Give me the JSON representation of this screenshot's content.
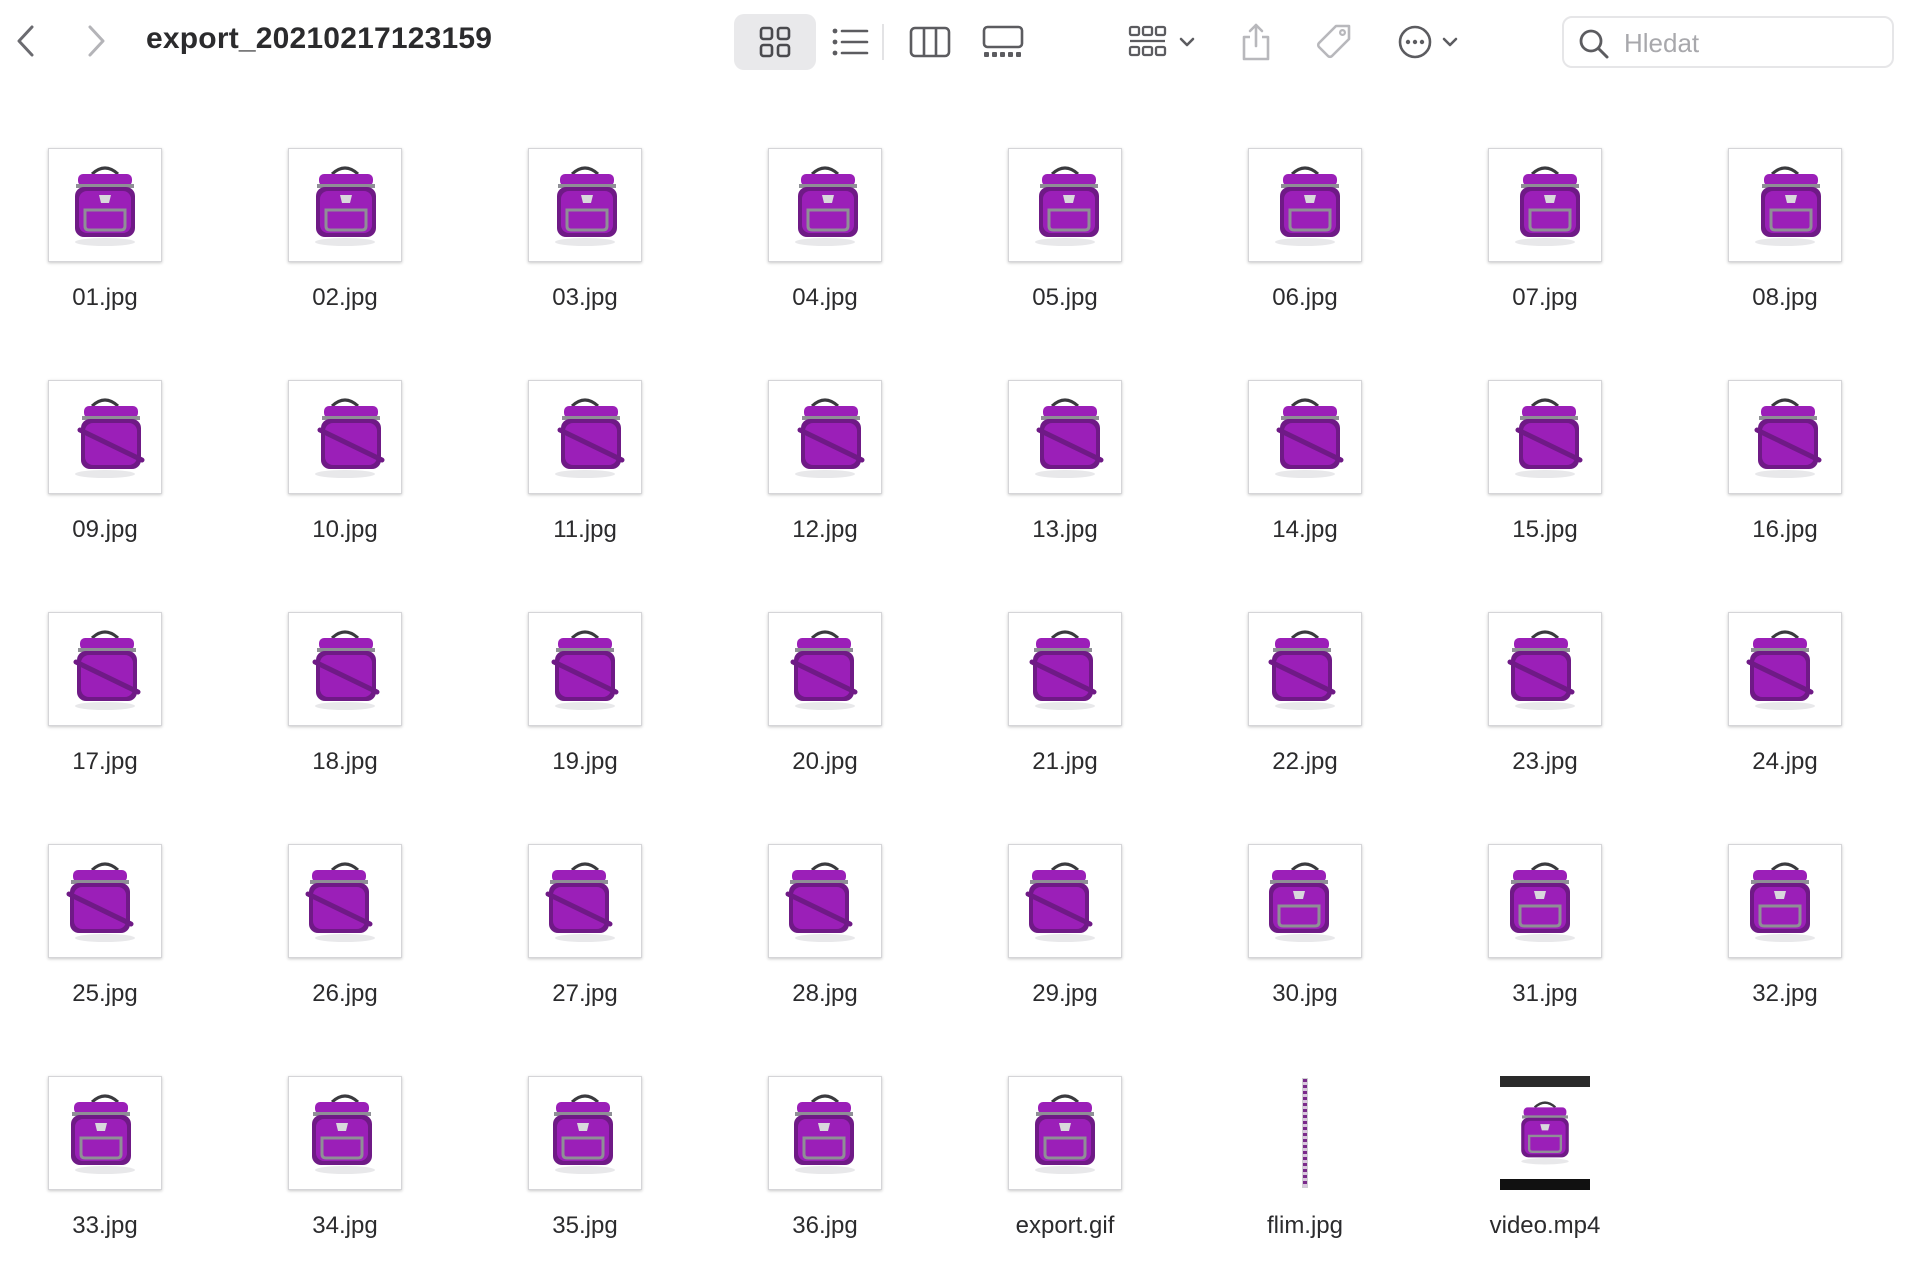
{
  "window": {
    "title": "export_20210217123159"
  },
  "toolbar": {
    "back_icon": "chevron-left-icon",
    "forward_icon": "chevron-right-icon",
    "view_modes": [
      "icons",
      "list",
      "columns",
      "gallery"
    ],
    "active_view": "icons",
    "group_icon": "group-grid-icon",
    "share_icon": "share-icon",
    "tags_icon": "tag-icon",
    "action_icon": "ellipsis-circle-icon"
  },
  "search": {
    "placeholder": "Hledat",
    "value": ""
  },
  "colors": {
    "accent_purple": "#9b1fb8",
    "bag_dark": "#6f1a86",
    "bag_gray": "#8f8f96",
    "toolbar_icon": "#5c5c60",
    "active_view_bg": "#e9e9eb"
  },
  "files": [
    {
      "name": "01.jpg",
      "kind": "image"
    },
    {
      "name": "02.jpg",
      "kind": "image"
    },
    {
      "name": "03.jpg",
      "kind": "image"
    },
    {
      "name": "04.jpg",
      "kind": "image"
    },
    {
      "name": "05.jpg",
      "kind": "image"
    },
    {
      "name": "06.jpg",
      "kind": "image"
    },
    {
      "name": "07.jpg",
      "kind": "image"
    },
    {
      "name": "08.jpg",
      "kind": "image"
    },
    {
      "name": "09.jpg",
      "kind": "image"
    },
    {
      "name": "10.jpg",
      "kind": "image"
    },
    {
      "name": "11.jpg",
      "kind": "image"
    },
    {
      "name": "12.jpg",
      "kind": "image"
    },
    {
      "name": "13.jpg",
      "kind": "image"
    },
    {
      "name": "14.jpg",
      "kind": "image"
    },
    {
      "name": "15.jpg",
      "kind": "image"
    },
    {
      "name": "16.jpg",
      "kind": "image"
    },
    {
      "name": "17.jpg",
      "kind": "image"
    },
    {
      "name": "18.jpg",
      "kind": "image"
    },
    {
      "name": "19.jpg",
      "kind": "image"
    },
    {
      "name": "20.jpg",
      "kind": "image"
    },
    {
      "name": "21.jpg",
      "kind": "image"
    },
    {
      "name": "22.jpg",
      "kind": "image"
    },
    {
      "name": "23.jpg",
      "kind": "image"
    },
    {
      "name": "24.jpg",
      "kind": "image"
    },
    {
      "name": "25.jpg",
      "kind": "image"
    },
    {
      "name": "26.jpg",
      "kind": "image"
    },
    {
      "name": "27.jpg",
      "kind": "image"
    },
    {
      "name": "28.jpg",
      "kind": "image"
    },
    {
      "name": "29.jpg",
      "kind": "image"
    },
    {
      "name": "30.jpg",
      "kind": "image"
    },
    {
      "name": "31.jpg",
      "kind": "image"
    },
    {
      "name": "32.jpg",
      "kind": "image"
    },
    {
      "name": "33.jpg",
      "kind": "image"
    },
    {
      "name": "34.jpg",
      "kind": "image"
    },
    {
      "name": "35.jpg",
      "kind": "image"
    },
    {
      "name": "36.jpg",
      "kind": "image"
    },
    {
      "name": "export.gif",
      "kind": "image"
    },
    {
      "name": "flim.jpg",
      "kind": "strip"
    },
    {
      "name": "video.mp4",
      "kind": "video"
    }
  ]
}
